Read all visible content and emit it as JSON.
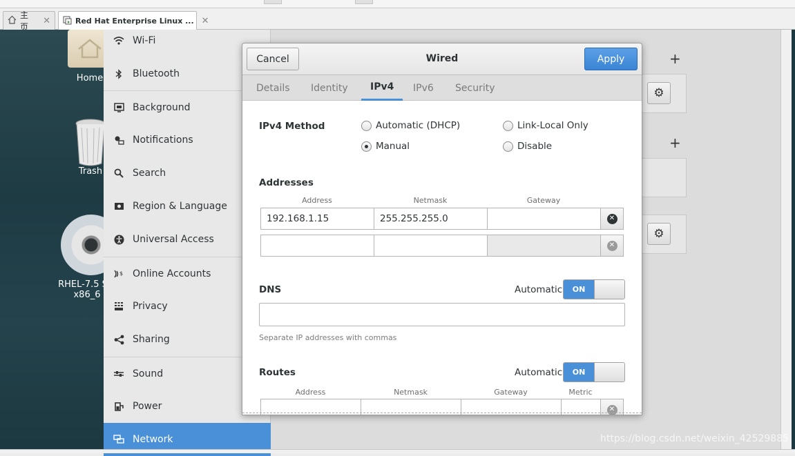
{
  "browser_tabs": [
    {
      "label": "主页",
      "icon": "home-icon"
    },
    {
      "label": "Red Hat Enterprise Linux ...",
      "icon": "vm-icon"
    }
  ],
  "desktop": {
    "icons": [
      {
        "label": "Home",
        "icon": "folder-home-icon"
      },
      {
        "label": "Trash",
        "icon": "trash-icon"
      },
      {
        "label": "RHEL-7.5 S",
        "label2": "x86_6",
        "icon": "disc-icon"
      }
    ]
  },
  "sidebar": {
    "items": [
      {
        "label": "Wi-Fi",
        "icon": "wifi-icon"
      },
      {
        "label": "Bluetooth",
        "icon": "bluetooth-icon"
      },
      {
        "label": "Background",
        "icon": "background-icon"
      },
      {
        "label": "Notifications",
        "icon": "notifications-icon"
      },
      {
        "label": "Search",
        "icon": "search-icon"
      },
      {
        "label": "Region & Language",
        "icon": "region-icon"
      },
      {
        "label": "Universal Access",
        "icon": "universal-access-icon"
      },
      {
        "label": "Online Accounts",
        "icon": "online-accounts-icon"
      },
      {
        "label": "Privacy",
        "icon": "privacy-icon"
      },
      {
        "label": "Sharing",
        "icon": "sharing-icon"
      },
      {
        "label": "Sound",
        "icon": "sound-icon"
      },
      {
        "label": "Power",
        "icon": "power-icon"
      },
      {
        "label": "Network",
        "icon": "network-icon",
        "active": true
      }
    ]
  },
  "dialog": {
    "cancel_label": "Cancel",
    "title": "Wired",
    "apply_label": "Apply",
    "tabs": [
      "Details",
      "Identity",
      "IPv4",
      "IPv6",
      "Security"
    ],
    "active_tab": "IPv4",
    "ipv4_method_label": "IPv4 Method",
    "methods": [
      {
        "label": "Automatic (DHCP)",
        "selected": false
      },
      {
        "label": "Link-Local Only",
        "selected": false
      },
      {
        "label": "Manual",
        "selected": true
      },
      {
        "label": "Disable",
        "selected": false
      }
    ],
    "addresses": {
      "title": "Addresses",
      "columns": [
        "Address",
        "Netmask",
        "Gateway"
      ],
      "rows": [
        {
          "address": "192.168.1.15",
          "netmask": "255.255.255.0",
          "gateway": ""
        },
        {
          "address": "",
          "netmask": "",
          "gateway": ""
        }
      ]
    },
    "dns": {
      "title": "DNS",
      "automatic_label": "Automatic",
      "switch_label": "ON",
      "value": "",
      "hint": "Separate IP addresses with commas"
    },
    "routes": {
      "title": "Routes",
      "automatic_label": "Automatic",
      "switch_label": "ON",
      "columns": [
        "Address",
        "Netmask",
        "Gateway",
        "Metric"
      ]
    }
  },
  "watermark": "https://blog.csdn.net/weixin_42529885",
  "colors": {
    "accent": "#4a90d9",
    "desktop_bg": "#24434c"
  }
}
